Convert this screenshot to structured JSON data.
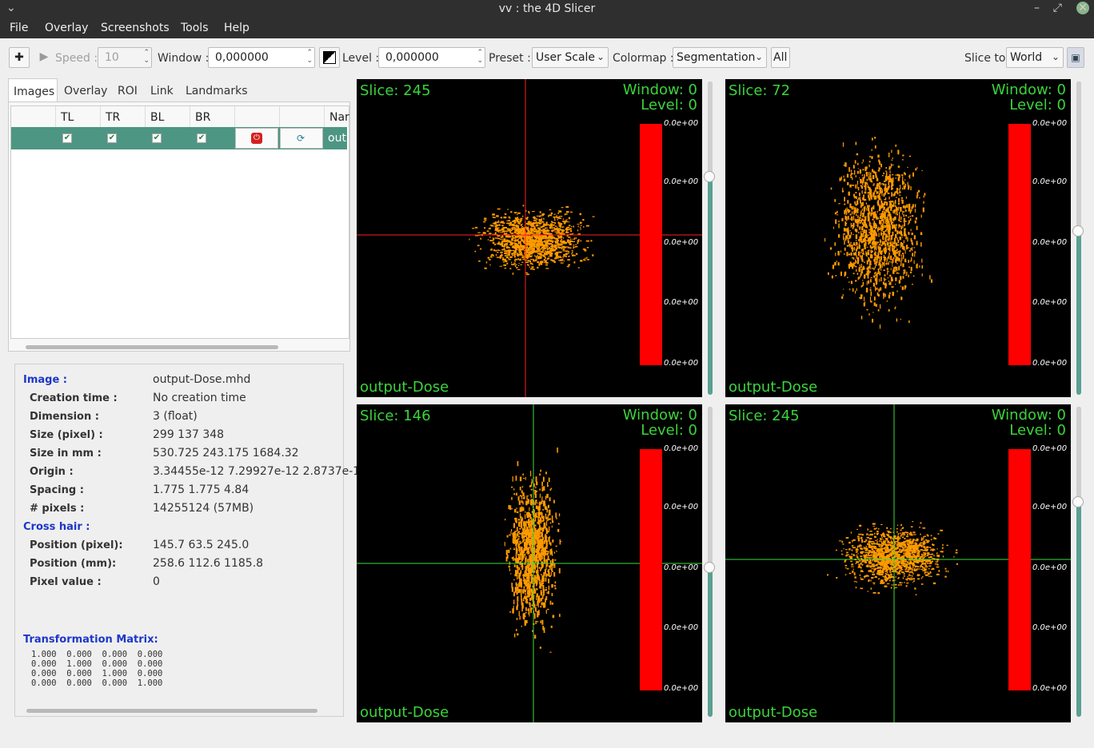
{
  "window": {
    "title": "vv : the 4D Slicer",
    "minimize": "–",
    "maximize": "⤢",
    "close": "✕"
  },
  "menu": [
    "File",
    "Overlay",
    "Screenshots",
    "Tools",
    "Help"
  ],
  "toolbar": {
    "crosshair_icon": "crosshair-icon",
    "speed_label": "Speed :",
    "speed_value": "10",
    "window_label": "Window :",
    "window_value": "0,000000",
    "level_label": "Level :",
    "level_value": "0,000000",
    "preset_label": "Preset :",
    "preset_value": "User Scale",
    "colormap_label": "Colormap :",
    "colormap_value": "Segmentation",
    "all_label": "All",
    "slice_to_label": "Slice to",
    "slice_to_value": "World"
  },
  "tabs": [
    "Images",
    "Overlay",
    "ROI",
    "Link",
    "Landmarks"
  ],
  "images_table": {
    "columns": [
      "TL",
      "TR",
      "BL",
      "BR",
      "Nar"
    ],
    "row": {
      "checked": [
        "✔",
        "✔",
        "✔",
        "✔"
      ],
      "name": "out"
    }
  },
  "info": {
    "image_label": "Image :",
    "image_value": "output-Dose.mhd",
    "rows": [
      {
        "label": "Creation time :",
        "value": "No creation time"
      },
      {
        "label": "Dimension :",
        "value": "3 (float)"
      },
      {
        "label": "Size (pixel) :",
        "value": "299 137 348"
      },
      {
        "label": "Size in mm :",
        "value": "530.725 243.175 1684.32"
      },
      {
        "label": "Origin :",
        "value": "3.34455e-12 7.29927e-12 2.8737e-1"
      },
      {
        "label": "Spacing :",
        "value": "1.775 1.775 4.84"
      },
      {
        "label": "# pixels :",
        "value": "14255124 (57MB)"
      }
    ],
    "crosshair_label": "Cross hair :",
    "crosshair_rows": [
      {
        "label": "Position (pixel):",
        "value": "145.7 63.5 245.0"
      },
      {
        "label": "Position (mm):",
        "value": "258.6 112.6 1185.8"
      },
      {
        "label": "Pixel value :",
        "value": "0"
      }
    ],
    "matrix_label": "Transformation Matrix:",
    "matrix": "1.000  0.000  0.000  0.000\n0.000  1.000  0.000  0.000\n0.000  0.000  1.000  0.000\n0.000  0.000  0.000  1.000"
  },
  "viewers": [
    {
      "slice": "Slice: 245",
      "window": "Window: 0",
      "level": "Level: 0",
      "name": "output-Dose",
      "crosshair_color": "#ff2020"
    },
    {
      "slice": "Slice: 72",
      "window": "Window: 0",
      "level": "Level: 0",
      "name": "output-Dose",
      "crosshair_color": ""
    },
    {
      "slice": "Slice: 146",
      "window": "Window: 0",
      "level": "Level: 0",
      "name": "output-Dose",
      "crosshair_color": "#3cdc3c"
    },
    {
      "slice": "Slice: 245",
      "window": "Window: 0",
      "level": "Level: 0",
      "name": "output-Dose",
      "crosshair_color": "#3cdc3c"
    }
  ],
  "colorbar_ticks": [
    "0.0e+00",
    "0.0e+00",
    "0.0e+00",
    "0.0e+00",
    "0.0e+00"
  ],
  "colors": {
    "dose": "#ff9a00",
    "overlay_text": "#3bd33b",
    "colorbar": "#ff0000",
    "selected_row": "#4d9683"
  }
}
